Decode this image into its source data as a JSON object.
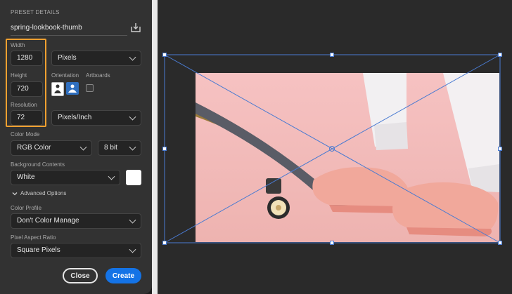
{
  "header": {
    "section_title": "PRESET DETAILS",
    "preset_name": "spring-lookbook-thumb"
  },
  "width": {
    "label": "Width",
    "value": "1280",
    "unit": "Pixels"
  },
  "height": {
    "label": "Height",
    "value": "720"
  },
  "orientation": {
    "label": "Orientation"
  },
  "artboards": {
    "label": "Artboards"
  },
  "resolution": {
    "label": "Resolution",
    "value": "72",
    "unit": "Pixels/Inch"
  },
  "color_mode": {
    "label": "Color Mode",
    "value": "RGB Color",
    "depth": "8 bit"
  },
  "background": {
    "label": "Background Contents",
    "value": "White",
    "swatch": "#ffffff"
  },
  "advanced": {
    "label": "Advanced Options"
  },
  "color_profile": {
    "label": "Color Profile",
    "value": "Don't Color Manage"
  },
  "pixel_aspect": {
    "label": "Pixel Aspect Ratio",
    "value": "Square Pixels"
  },
  "actions": {
    "close_label": "Close",
    "create_label": "Create"
  },
  "colors": {
    "accent": "#1473e6",
    "highlight": "#f0a030",
    "panel": "#323232"
  }
}
